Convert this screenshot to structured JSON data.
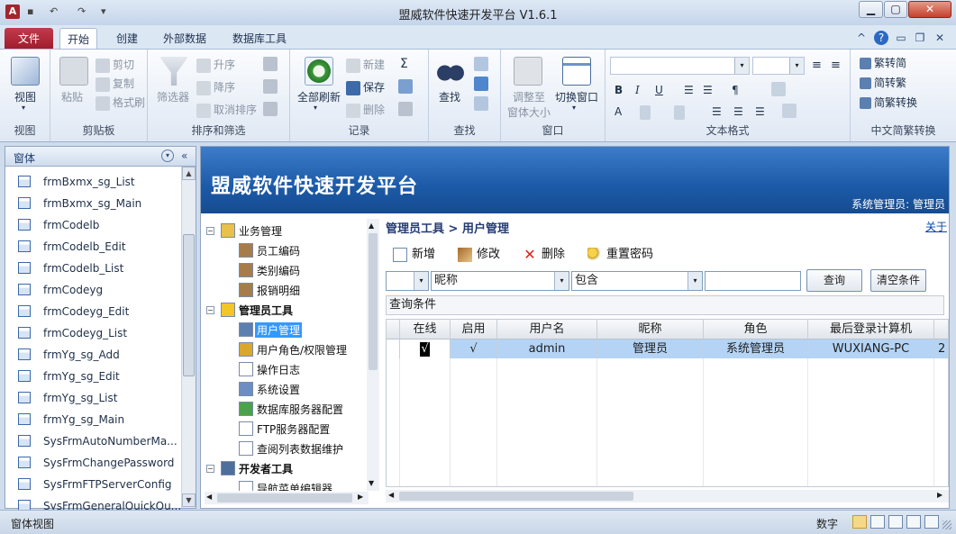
{
  "window": {
    "title": "盟威软件快速开发平台 V1.6.1",
    "app_icon": "A"
  },
  "ribbon_tabs": {
    "file": "文件",
    "tabs": [
      "开始",
      "创建",
      "外部数据",
      "数据库工具"
    ]
  },
  "ribbon": {
    "view": {
      "label": "视图",
      "group": "视图"
    },
    "clipboard": {
      "paste": "粘贴",
      "cut": "剪切",
      "copy": "复制",
      "format_painter": "格式刷",
      "group": "剪贴板"
    },
    "sort_filter": {
      "filter": "筛选器",
      "asc": "升序",
      "desc": "降序",
      "clear_sort": "取消排序",
      "group": "排序和筛选"
    },
    "records": {
      "refresh_all": "全部刷新",
      "new": "新建",
      "save": "保存",
      "delete": "删除",
      "group": "记录"
    },
    "find": {
      "find": "查找",
      "group": "查找"
    },
    "window": {
      "fit": "调整至\n窗体大小",
      "fit_line1": "调整至",
      "fit_line2": "窗体大小",
      "switch": "切换窗口",
      "group": "窗口"
    },
    "text_format": {
      "group": "文本格式"
    },
    "chinese": {
      "trad": "繁转简",
      "simp": "简转繁",
      "convert": "简繁转换",
      "group": "中文简繁转换"
    }
  },
  "nav_pane": {
    "title": "窗体",
    "items": [
      "frmBxmx_sg_List",
      "frmBxmx_sg_Main",
      "frmCodelb",
      "frmCodelb_Edit",
      "frmCodelb_List",
      "frmCodeyg",
      "frmCodeyg_Edit",
      "frmCodeyg_List",
      "frmYg_sg_Add",
      "frmYg_sg_Edit",
      "frmYg_sg_List",
      "frmYg_sg_Main",
      "SysFrmAutoNumberMa...",
      "SysFrmChangePassword",
      "SysFrmFTPServerConfig",
      "SysFrmGeneralQuickQu..."
    ]
  },
  "banner": {
    "title": "盟威软件快速开发平台",
    "user": "系统管理员: 管理员"
  },
  "tree": {
    "items": [
      {
        "label": "业务管理"
      },
      {
        "label": "员工编码"
      },
      {
        "label": "类别编码"
      },
      {
        "label": "报销明细"
      },
      {
        "label": "管理员工具"
      },
      {
        "label": "用户管理"
      },
      {
        "label": "用户角色/权限管理"
      },
      {
        "label": "操作日志"
      },
      {
        "label": "系统设置"
      },
      {
        "label": "数据库服务器配置"
      },
      {
        "label": "FTP服务器配置"
      },
      {
        "label": "查阅列表数据维护"
      },
      {
        "label": "开发者工具"
      },
      {
        "label": "导航菜单编辑器"
      }
    ]
  },
  "content": {
    "breadcrumb": "管理员工具 > 用户管理",
    "about": "关于",
    "toolbar": {
      "add": "新增",
      "edit": "修改",
      "delete": "删除",
      "reset_pwd": "重置密码"
    },
    "search": {
      "field": "昵称",
      "op": "包含",
      "value": "",
      "query": "查询",
      "clear": "清空条件"
    },
    "cond_label": "查询条件",
    "grid": {
      "headers": [
        "在线",
        "启用",
        "用户名",
        "昵称",
        "角色",
        "最后登录计算机"
      ],
      "row": [
        "√",
        "√",
        "admin",
        "管理员",
        "系统管理员",
        "WUXIANG-PC",
        "2"
      ]
    }
  },
  "status": {
    "left": "窗体视图",
    "mode": "数字"
  },
  "colors": {
    "banner": "#1c5aa7",
    "selection": "#3399ff",
    "file_tab": "#b02a3c"
  }
}
